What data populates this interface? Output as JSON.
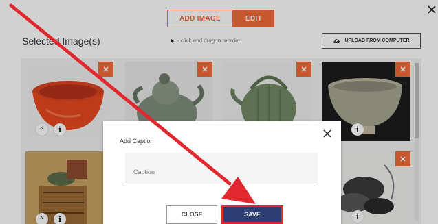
{
  "tabs": {
    "add_image": "ADD IMAGE",
    "edit": "EDIT"
  },
  "header": {
    "title": "Selected Image(s)",
    "hint": "- click and drag to reorder",
    "upload_label": "UPLOAD FROM COMPUTER"
  },
  "thumbs": [
    {
      "subject": "red bowl",
      "has_caption_icon": true,
      "has_info_icon": true
    },
    {
      "subject": "celadon turtle ewer",
      "has_caption_icon": false,
      "has_info_icon": false
    },
    {
      "subject": "green melon teapot",
      "has_caption_icon": false,
      "has_info_icon": false
    },
    {
      "subject": "stoneware bowl",
      "has_caption_icon": false,
      "has_info_icon": true
    },
    {
      "subject": "still life painting",
      "has_caption_icon": true,
      "has_info_icon": true
    },
    {
      "subject": "ink flower painting",
      "has_caption_icon": false,
      "has_info_icon": true
    }
  ],
  "icons": {
    "caption": "”",
    "info": "i"
  },
  "modal": {
    "title": "Add Caption",
    "caption_placeholder": "Caption",
    "close_label": "CLOSE",
    "save_label": "SAVE"
  },
  "colors": {
    "accent": "#f26b3a",
    "save_bg": "#2c3e73",
    "highlight": "#e0282e"
  }
}
